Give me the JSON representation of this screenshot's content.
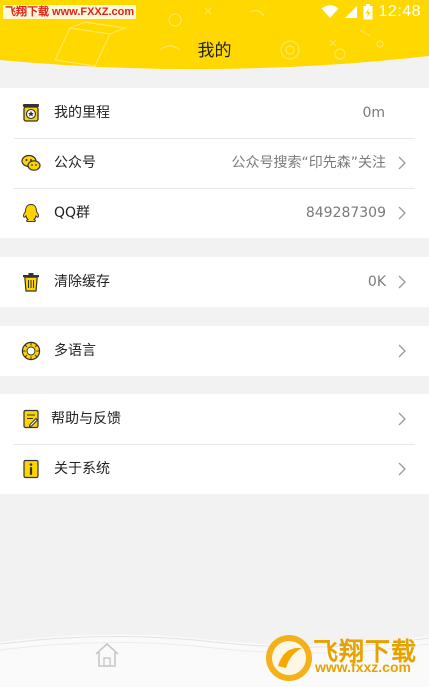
{
  "status_bar": {
    "watermark": "飞翔下载 www.FXXZ.com",
    "time": "12:48"
  },
  "header": {
    "title": "我的",
    "background": "#ffd800"
  },
  "groups": [
    {
      "items": [
        {
          "label": "我的里程",
          "value": "0m",
          "icon": "star-badge-icon",
          "chevron": false
        },
        {
          "label": "公众号",
          "value": "公众号搜索“印先森”关注",
          "icon": "wechat-icon",
          "chevron": true
        },
        {
          "label": "QQ群",
          "value": "849287309",
          "icon": "qq-penguin-icon",
          "chevron": true
        }
      ]
    },
    {
      "items": [
        {
          "label": "清除缓存",
          "value": "0K",
          "icon": "trash-icon",
          "chevron": true
        }
      ]
    },
    {
      "items": [
        {
          "label": "多语言",
          "value": "",
          "icon": "language-icon",
          "chevron": true
        }
      ]
    },
    {
      "items": [
        {
          "label": "帮助与反馈",
          "value": "",
          "icon": "feedback-icon",
          "chevron": true
        },
        {
          "label": "关于系统",
          "value": "",
          "icon": "info-icon",
          "chevron": true
        }
      ]
    }
  ],
  "bottom": {
    "home_icon": "home-icon",
    "watermark_text": "飞翔下载",
    "watermark_url": "www.fxxz.com"
  },
  "colors": {
    "accent_yellow": "#ffd800",
    "icon_yellow": "#ffd400",
    "value_gray": "#7a7a7a",
    "watermark_orange": "#e8a200"
  }
}
